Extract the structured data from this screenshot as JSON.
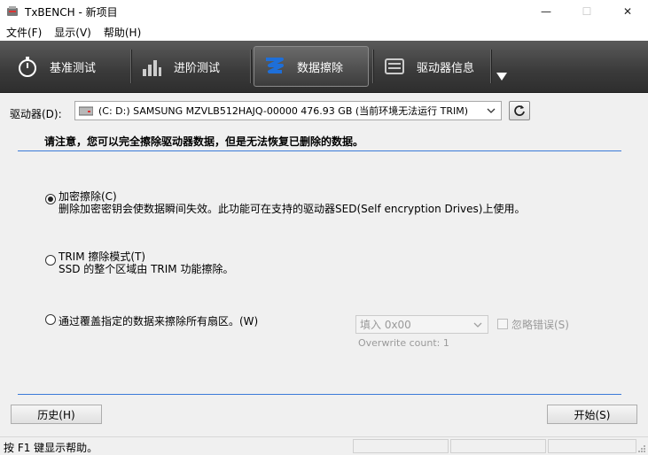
{
  "window": {
    "title": "TxBENCH - 新项目",
    "minimize": "—",
    "maximize": "☐",
    "close": "✕"
  },
  "menu": [
    "文件(F)",
    "显示(V)",
    "帮助(H)"
  ],
  "tabs": [
    {
      "label": "基准测试",
      "icon": "stopwatch-icon"
    },
    {
      "label": "进阶测试",
      "icon": "bar-chart-icon"
    },
    {
      "label": "数据擦除",
      "icon": "erase-icon",
      "active": true
    },
    {
      "label": "驱动器信息",
      "icon": "drive-info-icon"
    }
  ],
  "drive": {
    "label": "驱动器(D):",
    "selected": "(C: D:) SAMSUNG MZVLB512HAJQ-00000  476.93 GB (当前环境无法运行 TRIM)"
  },
  "warning": "请注意，您可以完全擦除驱动器数据，但是无法恢复已删除的数据。",
  "options": [
    {
      "title": "加密擦除(C)",
      "desc": "删除加密密钥会使数据瞬间失效。此功能可在支持的驱动器SED(Self encryption Drives)上使用。",
      "checked": true
    },
    {
      "title": "TRIM 擦除模式(T)",
      "desc": "SSD 的整个区域由 TRIM 功能擦除。",
      "checked": false
    },
    {
      "title": "通过覆盖指定的数据来擦除所有扇区。(W)",
      "checked": false
    }
  ],
  "fill": {
    "value": "填入 0x00",
    "ignore_errors": "忽略错误(S)",
    "overwrite_count": "Overwrite count: 1"
  },
  "buttons": {
    "history": "历史(H)",
    "start": "开始(S)"
  },
  "status": {
    "text": "按 F1 键显示帮助。"
  },
  "colors": {
    "accent_line": "#3a7ad8",
    "toolbar_dark": "#3a3a3a",
    "erase_icon": "#1e6fd9"
  }
}
